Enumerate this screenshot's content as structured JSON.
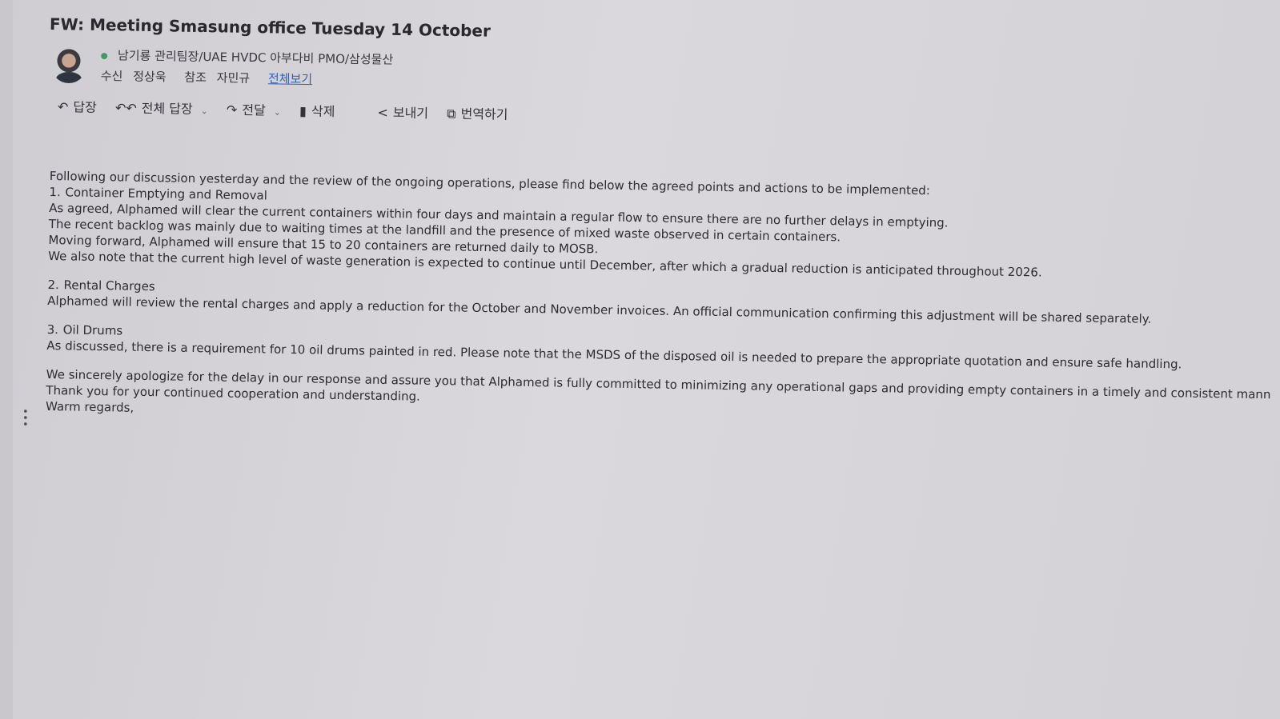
{
  "email": {
    "subject": "FW: Meeting Smasung office Tuesday 14 October",
    "sender": "남기룡  관리팀장/UAE HVDC 아부다비 PMO/삼성물산",
    "to_label": "수신",
    "to_value": "정상욱",
    "cc_label": "참조",
    "cc_value": "자민규",
    "view_all_link": "전체보기"
  },
  "toolbar": {
    "reply": "답장",
    "reply_all": "전체 답장",
    "forward": "전달",
    "delete": "삭제",
    "send": "보내기",
    "translate": "번역하기"
  },
  "body": {
    "intro": "Following our discussion yesterday and the review of the ongoing operations, please find below the agreed points and actions to be implemented:",
    "items": [
      {
        "number": "1.",
        "title": "Container Emptying and Removal",
        "lines": [
          "As agreed, Alphamed will clear the current containers within four days and maintain a regular flow to ensure there are no further delays in emptying.",
          "The recent backlog was mainly due to waiting times at the landfill and the presence of mixed waste observed in certain containers.",
          "Moving forward, Alphamed will ensure that 15 to 20 containers are returned daily to MOSB.",
          "We also note that the current high level of waste generation is expected to continue until December, after which a gradual reduction is anticipated throughout 2026."
        ]
      },
      {
        "number": "2.",
        "title": "Rental Charges",
        "lines": [
          "Alphamed will review the rental charges and apply a reduction for the October and November invoices. An official communication confirming this adjustment will be shared separately."
        ]
      },
      {
        "number": "3.",
        "title": "Oil Drums",
        "lines": [
          "As discussed, there is a requirement for 10 oil drums painted in red. Please note that the MSDS of the disposed oil is needed to prepare the appropriate quotation and ensure safe handling."
        ]
      }
    ],
    "closing": "We sincerely apologize for the delay in our response and assure you that Alphamed is fully committed to minimizing any operational gaps and providing empty containers in a timely and consistent mann",
    "thanks": "Thank you for your continued cooperation and understanding.",
    "regards": "Warm regards,"
  },
  "icons": {
    "reply": "reply-icon",
    "reply_all": "reply-all-icon",
    "forward": "forward-icon",
    "delete": "trash-icon",
    "send": "share-icon",
    "translate": "translate-icon",
    "more": "more-vertical-icon"
  },
  "colors": {
    "link": "#2d5fb8",
    "status_online": "#3f9c5c"
  }
}
